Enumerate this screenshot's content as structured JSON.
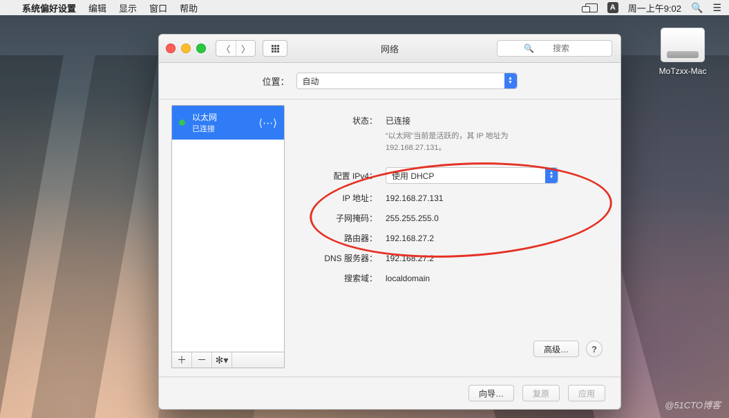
{
  "menubar": {
    "app": "系统偏好设置",
    "items": [
      "编辑",
      "显示",
      "窗口",
      "帮助"
    ],
    "ime": "A",
    "clock": "周一上午9:02"
  },
  "desktop": {
    "drive_label": "MoTzxx-Mac"
  },
  "window": {
    "title": "网络",
    "search_placeholder": "搜索",
    "location_label": "位置：",
    "location_value": "自动",
    "sidebar": {
      "service_name": "以太网",
      "service_status": "已连接"
    },
    "detail": {
      "status_label": "状态：",
      "status_value": "已连接",
      "status_note_1": "“以太网”当前是活跃的，其 IP 地址为",
      "status_note_2": "192.168.27.131。",
      "config_label": "配置 IPv4：",
      "config_value": "使用 DHCP",
      "ip_label": "IP 地址：",
      "ip_value": "192.168.27.131",
      "subnet_label": "子网掩码：",
      "subnet_value": "255.255.255.0",
      "router_label": "路由器：",
      "router_value": "192.168.27.2",
      "dns_label": "DNS 服务器：",
      "dns_value": "192.168.27.2",
      "search_label": "搜索域：",
      "search_value": "localdomain",
      "advanced_btn": "高级…"
    },
    "footer": {
      "wizard": "向导…",
      "restore": "复原",
      "apply": "应用"
    }
  },
  "watermark": "@51CTO博客"
}
